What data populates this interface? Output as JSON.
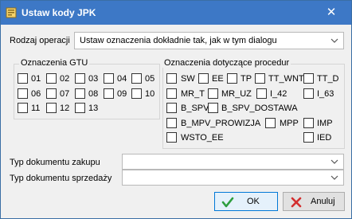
{
  "window": {
    "title": "Ustaw kody JPK",
    "icon": "jpk-app-icon",
    "close": "✕"
  },
  "operation": {
    "label": "Rodzaj operacji",
    "value": "Ustaw oznaczenia dokładnie tak, jak w tym dialogu"
  },
  "gtu": {
    "legend": "Oznaczenia GTU",
    "items": [
      "01",
      "02",
      "03",
      "04",
      "05",
      "06",
      "07",
      "08",
      "09",
      "10",
      "11",
      "12",
      "13"
    ]
  },
  "procedures": {
    "legend": "Oznaczenia dotyczące procedur",
    "items": [
      "SW",
      "EE",
      "TP",
      "TT_WNT",
      "TT_D",
      "MR_T",
      "MR_UZ",
      "I_42",
      "I_63",
      "B_SPV",
      "B_SPV_DOSTAWA",
      "B_MPV_PROWIZJA",
      "MPP",
      "IMP",
      "WSTO_EE",
      "IED"
    ]
  },
  "purchase": {
    "label": "Typ dokumentu zakupu",
    "value": ""
  },
  "sale": {
    "label": "Typ dokumentu sprzedaży",
    "value": ""
  },
  "buttons": {
    "ok": "OK",
    "cancel": "Anuluj"
  },
  "colors": {
    "titlebar": "#3d78c6",
    "ok_icon": "#2e9e3e",
    "cancel_icon": "#d32f2f"
  }
}
